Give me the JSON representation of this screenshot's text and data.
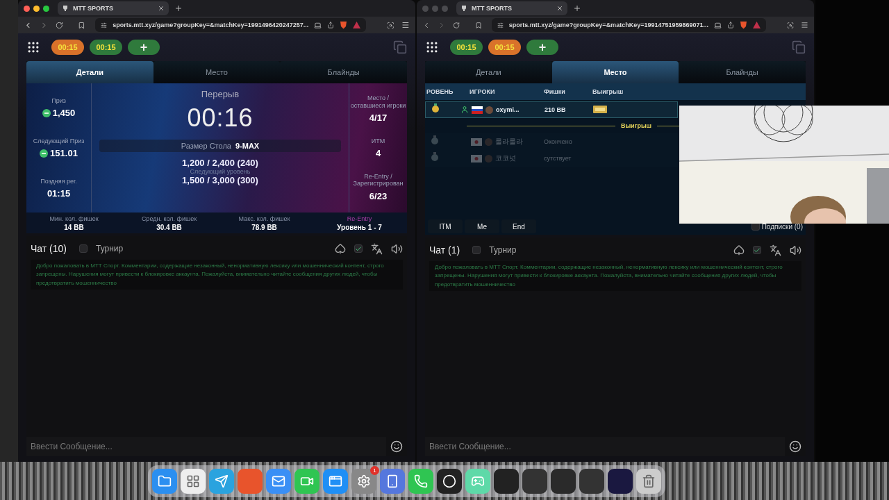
{
  "windows": [
    {
      "active": true,
      "tab_title": "MTT SPORTS",
      "url": "sports.mtt.xyz/game?groupKey=&matchKey=1991496420247257...",
      "timers": [
        {
          "label": "00:15",
          "color": "#d9722a"
        },
        {
          "label": "00:15",
          "color": "#2f7a3c"
        }
      ],
      "add_button": "+",
      "tabs": [
        {
          "label": "Детали",
          "selected": true
        },
        {
          "label": "Место",
          "selected": false
        },
        {
          "label": "Блайнды",
          "selected": false
        }
      ],
      "content": {
        "kind": "details",
        "left": [
          {
            "label": "Приз",
            "value": "1,450",
            "coin": true
          },
          {
            "label": "Следующий Приз",
            "value": "151.01",
            "coin": true
          },
          {
            "label": "Поздняя рег.",
            "value": "01:15",
            "coin": false
          }
        ],
        "title": "Перерыв",
        "clock": "00:16",
        "table_size_label": "Размер Стола",
        "table_size": "9-MAX",
        "blinds": "1,200 / 2,400 (240)",
        "next_label": "Следующий уровень",
        "next_blinds": "1,500 / 3,000 (300)",
        "right": [
          {
            "label": "Место / оставшиеся игроки",
            "value": "4/17"
          },
          {
            "label": "ИТМ",
            "value": "4"
          },
          {
            "label": "Re-Entry / Зарегистрирован",
            "value": "6/23"
          }
        ],
        "footer": [
          {
            "label": "Мин. кол. фишек",
            "value": "14 BB",
            "highlight": false
          },
          {
            "label": "Средн. кол. фишек",
            "value": "30.4 BB",
            "highlight": false
          },
          {
            "label": "Макс. кол. фишек",
            "value": "78.9 BB",
            "highlight": false
          },
          {
            "label": "Re-Entry",
            "value": "Уровень 1 - 7",
            "highlight": true
          }
        ]
      },
      "chat": {
        "title": "Чат (10)",
        "tournament": {
          "label": "Турнир",
          "checked": false
        },
        "filter_checked": true,
        "notice": "Добро пожаловать в МТТ Спорт. Комментарии, содержащие незаконный, ненормативную лексику или мошеннический контент, строго запрещены. Нарушения могут привести к блокировке аккаунта. Пожалуйста, внимательно читайте сообщения других людей, чтобы предотвратить мошенничество",
        "placeholder": "Ввести Сообщение..."
      }
    },
    {
      "active": false,
      "tab_title": "MTT SPORTS",
      "url": "sports.mtt.xyz/game?groupKey=&matchKey=19914751959869071...",
      "timers": [
        {
          "label": "00:15",
          "color": "#2f7a3c"
        },
        {
          "label": "00:15",
          "color": "#d9722a"
        }
      ],
      "add_button": "+",
      "tabs": [
        {
          "label": "Детали",
          "selected": false
        },
        {
          "label": "Место",
          "selected": true
        },
        {
          "label": "Блайнды",
          "selected": false
        }
      ],
      "content": {
        "kind": "standings",
        "columns": [
          "РОВЕНЬ",
          "ИГРОКИ",
          "Фишки",
          "Выигрыш"
        ],
        "rows": [
          {
            "player": "oxymi...",
            "cell": "210 BB",
            "eliminated": false
          }
        ],
        "divider": "Выигрыш",
        "rows_below": [
          {
            "player": "룰라룰라",
            "cell": "Окончено",
            "eliminated": true
          },
          {
            "player": "코코넛",
            "cell": "сутствует",
            "eliminated": true
          }
        ],
        "filters": [
          "ITM",
          "Me",
          "End"
        ],
        "subscriptions": {
          "label": "Подписки (0)",
          "checked": false
        }
      },
      "chat": {
        "title": "Чат (1)",
        "tournament": {
          "label": "Турнир",
          "checked": false
        },
        "filter_checked": true,
        "notice": "Добро пожаловать в МТТ Спорт. Комментарии, содержащие незаконный, ненормативную лексику или мошеннический контент, строго запрещены. Нарушения могут привести к блокировке аккаунта. Пожалуйста, внимательно читайте сообщения других людей, чтобы предотвратить мошенничество",
        "placeholder": "Ввести Сообщение..."
      }
    }
  ],
  "dock": {
    "badge": "1"
  }
}
